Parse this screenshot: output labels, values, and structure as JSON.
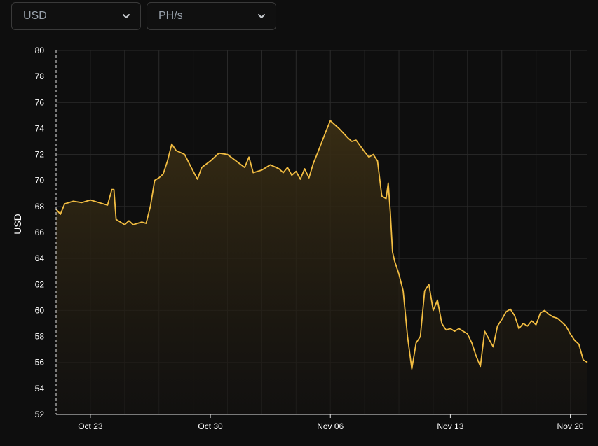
{
  "controls": {
    "currency": {
      "selected": "USD"
    },
    "unit": {
      "selected": "PH/s"
    }
  },
  "icons": {
    "dropdown": "chevron-down-icon"
  },
  "colors": {
    "background": "#0e0e0e",
    "line": "#f2bd42",
    "area_top": "#3a2e14",
    "grid": "#2a2a2a"
  },
  "chart_data": {
    "type": "area",
    "title": "",
    "xlabel": "",
    "ylabel": "USD",
    "ylim": [
      52,
      80
    ],
    "yticks": [
      52,
      54,
      56,
      58,
      60,
      62,
      64,
      66,
      68,
      70,
      72,
      74,
      76,
      78,
      80
    ],
    "xlim": [
      "2023-10-21",
      "2023-11-21"
    ],
    "xticks": [
      {
        "date": "2023-10-23",
        "label": "Oct 23"
      },
      {
        "date": "2023-10-30",
        "label": "Oct 30"
      },
      {
        "date": "2023-11-06",
        "label": "Nov 06"
      },
      {
        "date": "2023-11-13",
        "label": "Nov 13"
      },
      {
        "date": "2023-11-20",
        "label": "Nov 20"
      }
    ],
    "grid": true,
    "series": [
      {
        "values": [
          [
            "2023-10-21 00:00",
            67.8
          ],
          [
            "2023-10-21 06:00",
            67.4
          ],
          [
            "2023-10-21 12:00",
            68.2
          ],
          [
            "2023-10-22 00:00",
            68.4
          ],
          [
            "2023-10-22 12:00",
            68.3
          ],
          [
            "2023-10-23 00:00",
            68.5
          ],
          [
            "2023-10-23 12:00",
            68.3
          ],
          [
            "2023-10-24 00:00",
            68.1
          ],
          [
            "2023-10-24 06:00",
            69.3
          ],
          [
            "2023-10-24 09:00",
            69.3
          ],
          [
            "2023-10-24 12:00",
            67.0
          ],
          [
            "2023-10-25 00:00",
            66.6
          ],
          [
            "2023-10-25 06:00",
            66.9
          ],
          [
            "2023-10-25 12:00",
            66.6
          ],
          [
            "2023-10-26 00:00",
            66.8
          ],
          [
            "2023-10-26 06:00",
            66.7
          ],
          [
            "2023-10-26 12:00",
            68.0
          ],
          [
            "2023-10-26 18:00",
            70.0
          ],
          [
            "2023-10-27 00:00",
            70.2
          ],
          [
            "2023-10-27 06:00",
            70.5
          ],
          [
            "2023-10-27 12:00",
            71.5
          ],
          [
            "2023-10-27 18:00",
            72.8
          ],
          [
            "2023-10-28 00:00",
            72.3
          ],
          [
            "2023-10-28 12:00",
            72.0
          ],
          [
            "2023-10-29 00:00",
            70.7
          ],
          [
            "2023-10-29 06:00",
            70.1
          ],
          [
            "2023-10-29 12:00",
            71.0
          ],
          [
            "2023-10-30 00:00",
            71.5
          ],
          [
            "2023-10-30 12:00",
            72.1
          ],
          [
            "2023-10-31 00:00",
            72.0
          ],
          [
            "2023-10-31 12:00",
            71.5
          ],
          [
            "2023-11-01 00:00",
            71.0
          ],
          [
            "2023-11-01 06:00",
            71.8
          ],
          [
            "2023-11-01 12:00",
            70.6
          ],
          [
            "2023-11-02 00:00",
            70.8
          ],
          [
            "2023-11-02 12:00",
            71.2
          ],
          [
            "2023-11-03 00:00",
            70.9
          ],
          [
            "2023-11-03 06:00",
            70.6
          ],
          [
            "2023-11-03 12:00",
            71.0
          ],
          [
            "2023-11-03 18:00",
            70.4
          ],
          [
            "2023-11-04 00:00",
            70.7
          ],
          [
            "2023-11-04 06:00",
            70.1
          ],
          [
            "2023-11-04 12:00",
            70.9
          ],
          [
            "2023-11-04 18:00",
            70.2
          ],
          [
            "2023-11-05 00:00",
            71.3
          ],
          [
            "2023-11-05 06:00",
            72.1
          ],
          [
            "2023-11-05 18:00",
            73.8
          ],
          [
            "2023-11-06 00:00",
            74.6
          ],
          [
            "2023-11-06 06:00",
            74.3
          ],
          [
            "2023-11-06 12:00",
            74.0
          ],
          [
            "2023-11-07 00:00",
            73.3
          ],
          [
            "2023-11-07 06:00",
            73.0
          ],
          [
            "2023-11-07 12:00",
            73.1
          ],
          [
            "2023-11-08 00:00",
            72.2
          ],
          [
            "2023-11-08 06:00",
            71.8
          ],
          [
            "2023-11-08 12:00",
            72.0
          ],
          [
            "2023-11-08 18:00",
            71.5
          ],
          [
            "2023-11-09 00:00",
            68.8
          ],
          [
            "2023-11-09 06:00",
            68.6
          ],
          [
            "2023-11-09 09:00",
            69.8
          ],
          [
            "2023-11-09 12:00",
            67.5
          ],
          [
            "2023-11-09 15:00",
            64.5
          ],
          [
            "2023-11-09 18:00",
            63.8
          ],
          [
            "2023-11-10 00:00",
            62.8
          ],
          [
            "2023-11-10 06:00",
            61.5
          ],
          [
            "2023-11-10 12:00",
            58.0
          ],
          [
            "2023-11-10 18:00",
            55.5
          ],
          [
            "2023-11-11 00:00",
            57.5
          ],
          [
            "2023-11-11 06:00",
            58.0
          ],
          [
            "2023-11-11 12:00",
            61.5
          ],
          [
            "2023-11-11 18:00",
            62.0
          ],
          [
            "2023-11-12 00:00",
            60.0
          ],
          [
            "2023-11-12 06:00",
            60.8
          ],
          [
            "2023-11-12 12:00",
            59.0
          ],
          [
            "2023-11-12 18:00",
            58.5
          ],
          [
            "2023-11-13 00:00",
            58.6
          ],
          [
            "2023-11-13 06:00",
            58.4
          ],
          [
            "2023-11-13 12:00",
            58.6
          ],
          [
            "2023-11-14 00:00",
            58.2
          ],
          [
            "2023-11-14 06:00",
            57.5
          ],
          [
            "2023-11-14 12:00",
            56.5
          ],
          [
            "2023-11-14 18:00",
            55.7
          ],
          [
            "2023-11-15 00:00",
            58.4
          ],
          [
            "2023-11-15 06:00",
            57.8
          ],
          [
            "2023-11-15 12:00",
            57.2
          ],
          [
            "2023-11-15 18:00",
            58.8
          ],
          [
            "2023-11-16 00:00",
            59.3
          ],
          [
            "2023-11-16 06:00",
            59.9
          ],
          [
            "2023-11-16 12:00",
            60.1
          ],
          [
            "2023-11-16 18:00",
            59.6
          ],
          [
            "2023-11-17 00:00",
            58.6
          ],
          [
            "2023-11-17 06:00",
            59.0
          ],
          [
            "2023-11-17 12:00",
            58.8
          ],
          [
            "2023-11-17 18:00",
            59.2
          ],
          [
            "2023-11-18 00:00",
            58.9
          ],
          [
            "2023-11-18 06:00",
            59.8
          ],
          [
            "2023-11-18 12:00",
            60.0
          ],
          [
            "2023-11-18 18:00",
            59.7
          ],
          [
            "2023-11-19 00:00",
            59.5
          ],
          [
            "2023-11-19 06:00",
            59.4
          ],
          [
            "2023-11-19 12:00",
            59.1
          ],
          [
            "2023-11-19 18:00",
            58.8
          ],
          [
            "2023-11-20 00:00",
            58.2
          ],
          [
            "2023-11-20 06:00",
            57.7
          ],
          [
            "2023-11-20 12:00",
            57.4
          ],
          [
            "2023-11-20 18:00",
            56.2
          ],
          [
            "2023-11-21 00:00",
            56.0
          ]
        ]
      }
    ]
  }
}
